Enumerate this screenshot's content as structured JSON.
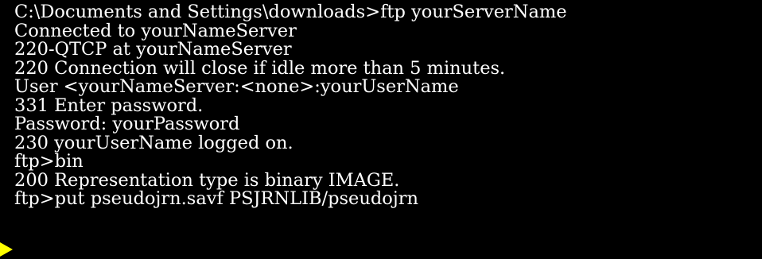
{
  "terminal": {
    "lines": [
      "C:\\Documents and Settings\\downloads>ftp yourServerName",
      "Connected to yourNameServer",
      "220-QTCP at yourNameServer",
      "220 Connection will close if idle more than 5 minutes.",
      "User <yourNameServer:<none>:yourUserName",
      "331 Enter password.",
      "Password: yourPassword",
      "230 yourUserName logged on.",
      "ftp>bin",
      "200 Representation type is binary IMAGE.",
      "ftp>put pseudojrn.savf PSJRNLIB/pseudojrn"
    ]
  },
  "colors": {
    "background": "#000000",
    "text": "#ffffff",
    "marker": "#ffff00"
  },
  "icons": {
    "current_line_marker": "yellow-arrow-icon"
  }
}
